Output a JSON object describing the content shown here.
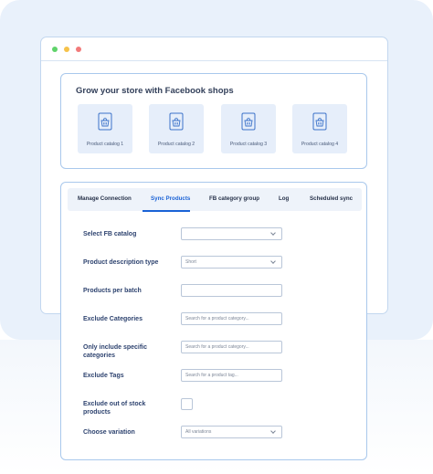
{
  "colors": {
    "accent": "#1a62d6",
    "background": "#e9f1fb",
    "card_border": "#a9c8ec",
    "dot_green": "#5fd36a",
    "dot_yellow": "#f6c24a",
    "dot_red": "#f27a7a"
  },
  "shops": {
    "title": "Grow your store with Facebook shops",
    "catalogs": [
      {
        "label": "Product catalog 1",
        "icon": "shopping-basket-icon"
      },
      {
        "label": "Product catalog 2",
        "icon": "shopping-basket-icon"
      },
      {
        "label": "Product catalog 3",
        "icon": "shopping-basket-icon"
      },
      {
        "label": "Product catalog 4",
        "icon": "shopping-basket-icon"
      }
    ]
  },
  "sync": {
    "tabs": [
      {
        "label": "Manage Connection",
        "active": false
      },
      {
        "label": "Sync Products",
        "active": true
      },
      {
        "label": "FB category group",
        "active": false
      },
      {
        "label": "Log",
        "active": false
      },
      {
        "label": "Scheduled sync",
        "active": false
      }
    ],
    "form": {
      "select_catalog": {
        "label": "Select FB catalog",
        "value": ""
      },
      "description_type": {
        "label": "Product description type",
        "value": "Short"
      },
      "per_batch": {
        "label": "Products per batch",
        "value": ""
      },
      "exclude_categories": {
        "label": "Exclude Categories",
        "placeholder": "Search for a product category..."
      },
      "include_categories": {
        "label": "Only include specific categories",
        "placeholder": "Search for a product category..."
      },
      "exclude_tags": {
        "label": "Exclude Tags",
        "placeholder": "Search for a product tag..."
      },
      "exclude_out_of_stock": {
        "label": "Exclude out of stock products",
        "checked": false
      },
      "variation": {
        "label": "Choose variation",
        "value": "All variations"
      }
    }
  }
}
